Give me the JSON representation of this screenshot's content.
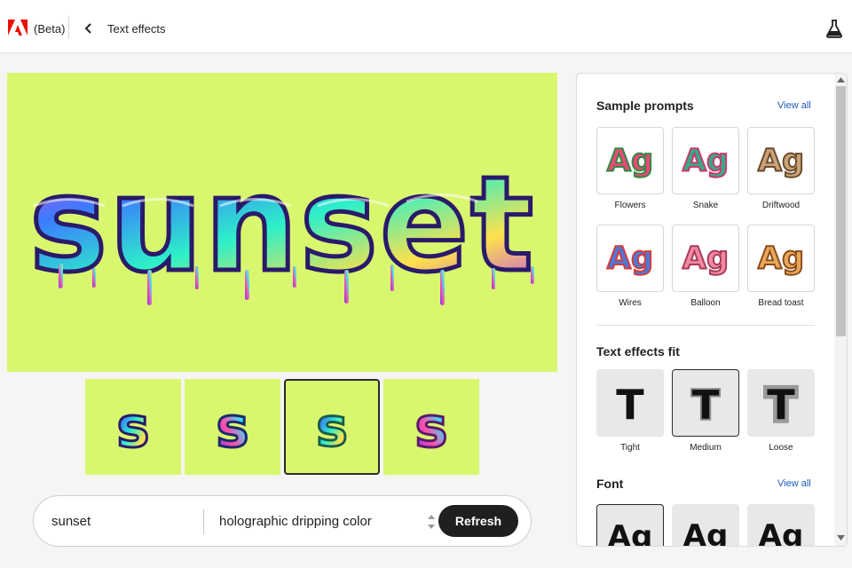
{
  "header": {
    "beta_label": "(Beta)",
    "title": "Text effects",
    "logo_icon": "adobe-logo",
    "back_icon": "chevron-left-icon",
    "labs_icon": "flask-icon"
  },
  "canvas": {
    "text": "sunset",
    "background": "#d9f76e"
  },
  "variations": [
    {
      "letter": "s",
      "selected": false
    },
    {
      "letter": "s",
      "selected": false
    },
    {
      "letter": "s",
      "selected": true
    },
    {
      "letter": "s",
      "selected": false
    }
  ],
  "prompt": {
    "text_value": "sunset",
    "style_value": "holographic dripping color",
    "refresh_label": "Refresh"
  },
  "panel": {
    "sample_prompts": {
      "title": "Sample prompts",
      "view_all": "View all",
      "items": [
        {
          "label": "Flowers",
          "glyph": "Ag"
        },
        {
          "label": "Snake",
          "glyph": "Ag"
        },
        {
          "label": "Driftwood",
          "glyph": "Ag"
        },
        {
          "label": "Wires",
          "glyph": "Ag"
        },
        {
          "label": "Balloon",
          "glyph": "Ag"
        },
        {
          "label": "Bread toast",
          "glyph": "Ag"
        }
      ]
    },
    "fit": {
      "title": "Text effects fit",
      "items": [
        {
          "label": "Tight",
          "glyph": "T"
        },
        {
          "label": "Medium",
          "glyph": "T",
          "selected": true
        },
        {
          "label": "Loose",
          "glyph": "T"
        }
      ]
    },
    "font": {
      "title": "Font",
      "view_all": "View all",
      "items": [
        {
          "glyph": "Ag",
          "selected": true
        },
        {
          "glyph": "Ag"
        },
        {
          "glyph": "Ag"
        }
      ]
    }
  },
  "colors": {
    "accent_link": "#1f5bbf",
    "canvas_bg": "#d9f76e",
    "button_dark": "#1f1f1f",
    "adobe_red": "#eb1000"
  }
}
